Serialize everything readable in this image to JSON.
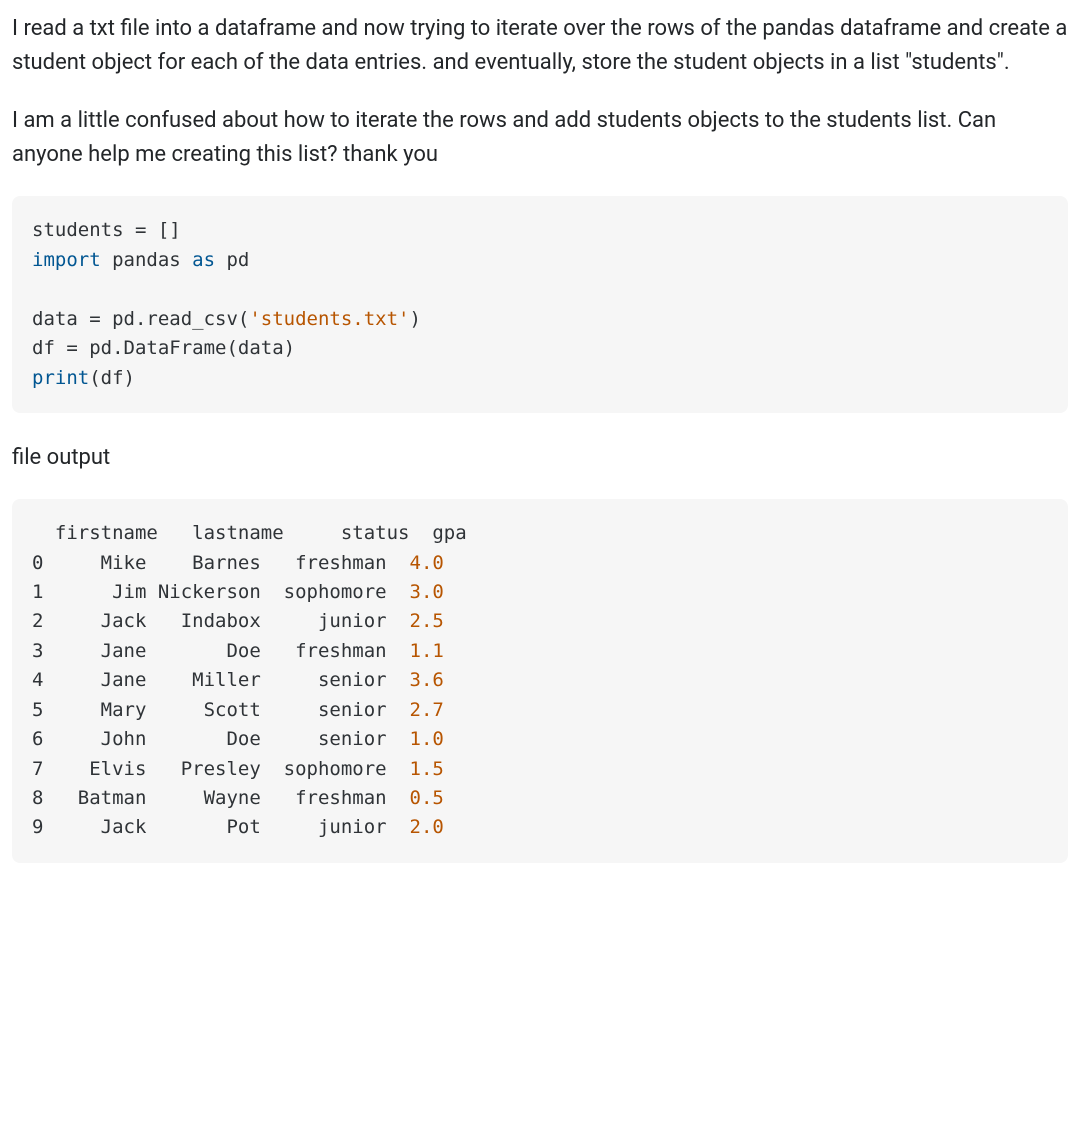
{
  "post": {
    "para1": "I read a txt file into a dataframe and now trying to iterate over the rows of the pandas dataframe and create a student object for each of the data entries. and eventually, store the student objects in a list \"students\".",
    "para2": "I am a little confused about how to iterate the rows and add students objects to the students list. Can anyone help me creating this list? thank you",
    "para3": "file output"
  },
  "code1": {
    "t0": "students = []",
    "kw_import": "import",
    "t1": " pandas ",
    "kw_as": "as",
    "t2": " pd",
    "t3": "data = pd.read_csv(",
    "str_file": "'students.txt'",
    "t4": ")",
    "t5": "df = pd.DataFrame(data)",
    "builtin_print": "print",
    "t6": "(df)"
  },
  "output": {
    "header": "  firstname   lastname     status  gpa",
    "rows": [
      {
        "idx": "0",
        "fn": "     Mike",
        "ln": "    Barnes",
        "st": "   freshman",
        "gpa": "4.0"
      },
      {
        "idx": "1",
        "fn": "      Jim",
        "ln": " Nickerson",
        "st": "  sophomore",
        "gpa": "3.0"
      },
      {
        "idx": "2",
        "fn": "     Jack",
        "ln": "   Indabox",
        "st": "     junior",
        "gpa": "2.5"
      },
      {
        "idx": "3",
        "fn": "     Jane",
        "ln": "       Doe",
        "st": "   freshman",
        "gpa": "1.1"
      },
      {
        "idx": "4",
        "fn": "     Jane",
        "ln": "    Miller",
        "st": "     senior",
        "gpa": "3.6"
      },
      {
        "idx": "5",
        "fn": "     Mary",
        "ln": "     Scott",
        "st": "     senior",
        "gpa": "2.7"
      },
      {
        "idx": "6",
        "fn": "     John",
        "ln": "       Doe",
        "st": "     senior",
        "gpa": "1.0"
      },
      {
        "idx": "7",
        "fn": "    Elvis",
        "ln": "   Presley",
        "st": "  sophomore",
        "gpa": "1.5"
      },
      {
        "idx": "8",
        "fn": "   Batman",
        "ln": "     Wayne",
        "st": "   freshman",
        "gpa": "0.5"
      },
      {
        "idx": "9",
        "fn": "     Jack",
        "ln": "       Pot",
        "st": "     junior",
        "gpa": "2.0"
      }
    ]
  }
}
